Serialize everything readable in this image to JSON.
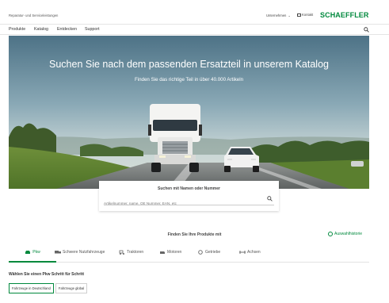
{
  "header": {
    "tagline": "Reparatur- und Serviceleistungen",
    "company_menu": "Unternehmen",
    "contact": "Kontakt",
    "logo": "SCHAEFFLER"
  },
  "nav": {
    "items": [
      "Produkte",
      "Katalog",
      "Entdecken",
      "Support"
    ]
  },
  "hero": {
    "title": "Suchen Sie nach dem passenden Ersatzteil in unserem Katalog",
    "subtitle": "Finden Sie das richtige Teil in über 40.000 Artikeln"
  },
  "search": {
    "title": "Suchen mit Namen oder Nummer",
    "placeholder": "Artikelnummer, name, OE Nummer, EAN, etc"
  },
  "products": {
    "heading": "Finden Sie Ihre Produkte mit",
    "history_link": "Auswahlhistorie",
    "tabs": [
      {
        "label": "Pkw",
        "icon": "car-icon",
        "active": true
      },
      {
        "label": "Schwere Nutzfahrzeuge",
        "icon": "truck-icon",
        "active": false
      },
      {
        "label": "Traktoren",
        "icon": "tractor-icon",
        "active": false
      },
      {
        "label": "Motoren",
        "icon": "engine-icon",
        "active": false
      },
      {
        "label": "Getriebe",
        "icon": "gearbox-icon",
        "active": false
      },
      {
        "label": "Achsen",
        "icon": "axle-icon",
        "active": false
      }
    ]
  },
  "steps": {
    "label": "Wählen Sie einen Pkw Schritt für Schritt",
    "buttons": [
      "Fahrzeuge in Deutschland",
      "Fahrzeuge global"
    ]
  },
  "colors": {
    "brand_green": "#00893d"
  }
}
